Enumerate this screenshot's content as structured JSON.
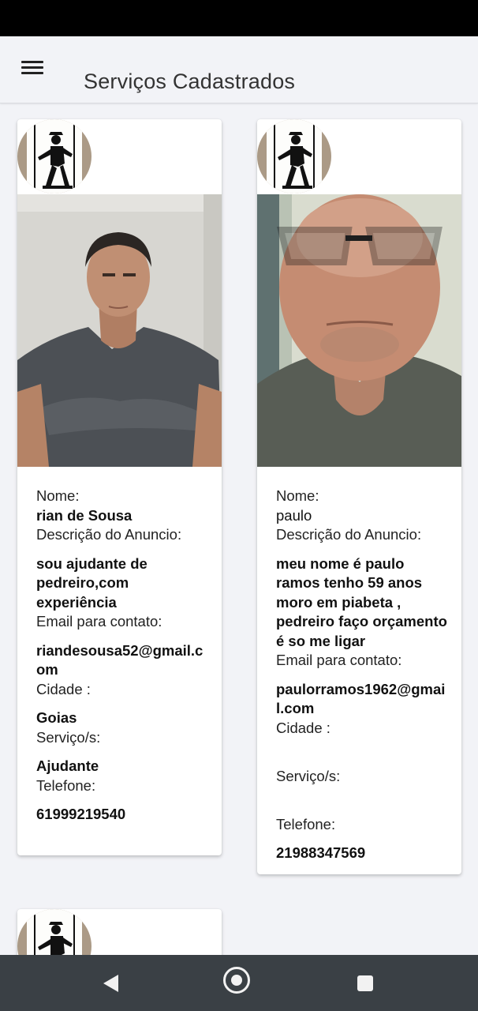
{
  "app": {
    "title": "Serviços Cadastrados"
  },
  "cards": [
    {
      "nome_label": "Nome:",
      "nome": "rian de Sousa",
      "descricao_label": "Descrição do Anuncio:",
      "descricao": "sou ajudante de pedreiro,com experiência",
      "email_label": "Email para contato:",
      "email": "riandesousa52@gmail.com",
      "cidade_label": "Cidade :",
      "cidade": "Goias",
      "servico_label": "Serviço/s:",
      "servico": "Ajudante",
      "telefone_label": "Telefone:",
      "telefone": "61999219540"
    },
    {
      "nome_label": "Nome:",
      "nome": "paulo",
      "descricao_label": "Descrição do Anuncio:",
      "descricao": "meu nome é paulo ramos tenho 59 anos moro em piabeta , pedreiro faço orçamento é so me ligar",
      "email_label": "Email para contato:",
      "email": "paulorramos1962@gmail.com",
      "cidade_label": "Cidade :",
      "cidade": "",
      "servico_label": "Serviço/s:",
      "servico": "",
      "telefone_label": "Telefone:",
      "telefone": "21988347569"
    }
  ],
  "icons": {
    "menu": "menu-icon",
    "logo": "worker-logo",
    "back": "back-icon",
    "home": "home-icon",
    "recent": "recent-apps-icon"
  }
}
